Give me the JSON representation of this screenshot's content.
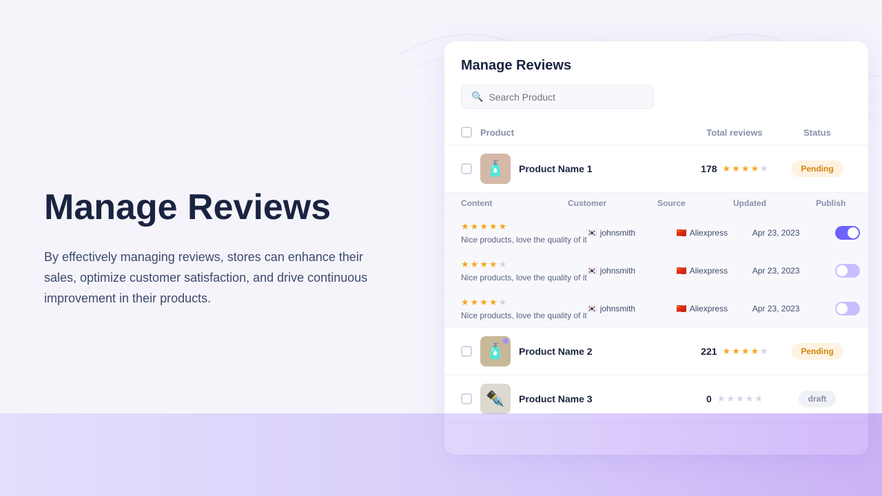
{
  "page": {
    "title": "Manage Reviews",
    "description": "By effectively managing reviews, stores can enhance their sales, optimize customer satisfaction, and drive continuous improvement in their products."
  },
  "search": {
    "placeholder": "Search Product"
  },
  "table": {
    "headers": {
      "product": "Product",
      "total_reviews": "Total reviews",
      "status": "Status"
    },
    "sub_headers": {
      "content": "Content",
      "customer": "Customer",
      "source": "Source",
      "updated": "Updated",
      "publish": "Publish"
    }
  },
  "products": [
    {
      "id": 1,
      "name": "Product Name 1",
      "thumb_emoji": "🧴",
      "thumb_color": "brown",
      "total_reviews": 178,
      "stars": [
        true,
        true,
        true,
        true,
        false
      ],
      "status": "Pending",
      "expanded": true,
      "has_dot": false,
      "reviews": [
        {
          "stars": [
            true,
            true,
            true,
            true,
            true
          ],
          "text": "Nice products, love the quality of it",
          "customer_flag": "🇰🇷",
          "customer": "johnsmith",
          "source_flag": "🇨🇳",
          "source": "Aliexpress",
          "updated": "Apr 23, 2023",
          "publish": true
        },
        {
          "stars": [
            true,
            true,
            true,
            true,
            false
          ],
          "text": "Nice products, love the quality of it",
          "customer_flag": "🇰🇷",
          "customer": "johnsmith",
          "source_flag": "🇨🇳",
          "source": "Aliexpress",
          "updated": "Apr 23, 2023",
          "publish": false
        },
        {
          "stars": [
            true,
            true,
            true,
            true,
            false
          ],
          "text": "Nice products, love the quality of it",
          "customer_flag": "🇰🇷",
          "customer": "johnsmith",
          "source_flag": "🇨🇳",
          "source": "Aliexpress",
          "updated": "Apr 23, 2023",
          "publish": false
        }
      ]
    },
    {
      "id": 2,
      "name": "Product Name 2",
      "thumb_emoji": "🧴",
      "thumb_color": "dark",
      "total_reviews": 221,
      "stars": [
        true,
        true,
        true,
        true,
        false
      ],
      "status": "Pending",
      "expanded": false,
      "has_dot": true,
      "reviews": []
    },
    {
      "id": 3,
      "name": "Product Name 3",
      "thumb_emoji": "✒️",
      "thumb_color": "light",
      "total_reviews": 0,
      "stars": [
        false,
        false,
        false,
        false,
        false
      ],
      "status": "draft",
      "expanded": false,
      "has_dot": false,
      "reviews": []
    }
  ]
}
